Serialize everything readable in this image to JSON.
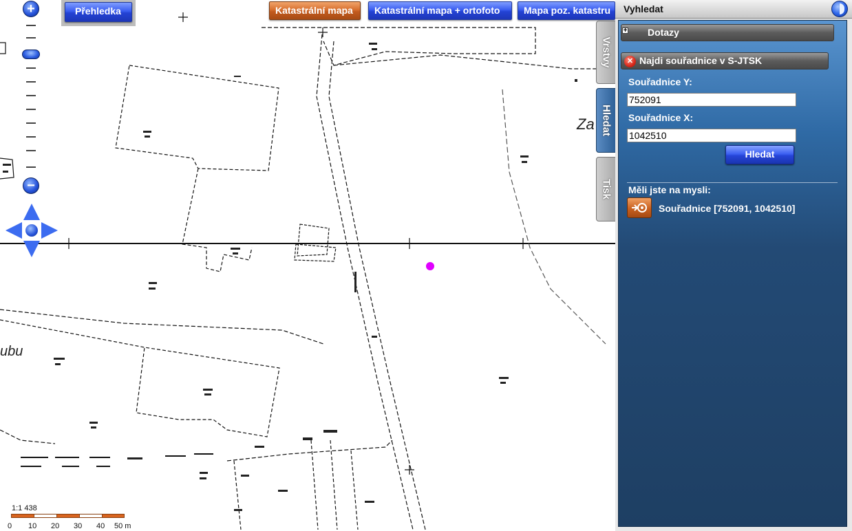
{
  "map": {
    "overview_button": "Přehledka",
    "layer_buttons": [
      {
        "label": "Katastrální mapa",
        "active": true
      },
      {
        "label": "Katastrální mapa + ortofoto",
        "active": false
      },
      {
        "label": "Mapa poz. katastru",
        "active": false
      }
    ],
    "zoom_in": "+",
    "zoom_out": "−",
    "map_labels": {
      "place_1": "Za",
      "place_2": "ubu"
    },
    "marker_color": "#e000ff",
    "scale": {
      "ratio": "1:1 438",
      "ticks": [
        "0",
        "10",
        "20",
        "30",
        "40",
        "50 m"
      ]
    }
  },
  "tabs": [
    {
      "label": "Vrstvy",
      "active": false
    },
    {
      "label": "Hledat",
      "active": true
    },
    {
      "label": "Tisk",
      "active": false
    }
  ],
  "panel": {
    "title": "Vyhledat",
    "queries_section": "Dotazy",
    "find_section": "Najdi souřadnice v S-JTSK",
    "coord_y_label": "Souřadnice Y:",
    "coord_y_value": "752091",
    "coord_x_label": "Souřadnice X:",
    "coord_x_value": "1042510",
    "search_button": "Hledat",
    "did_you_mean": "Měli jste na mysli:",
    "result": "Souřadnice [752091, 1042510]"
  },
  "colors": {
    "accent_blue": "#2f5ae6",
    "active_orange": "#c8601f",
    "panel_blue": "#234a75"
  }
}
